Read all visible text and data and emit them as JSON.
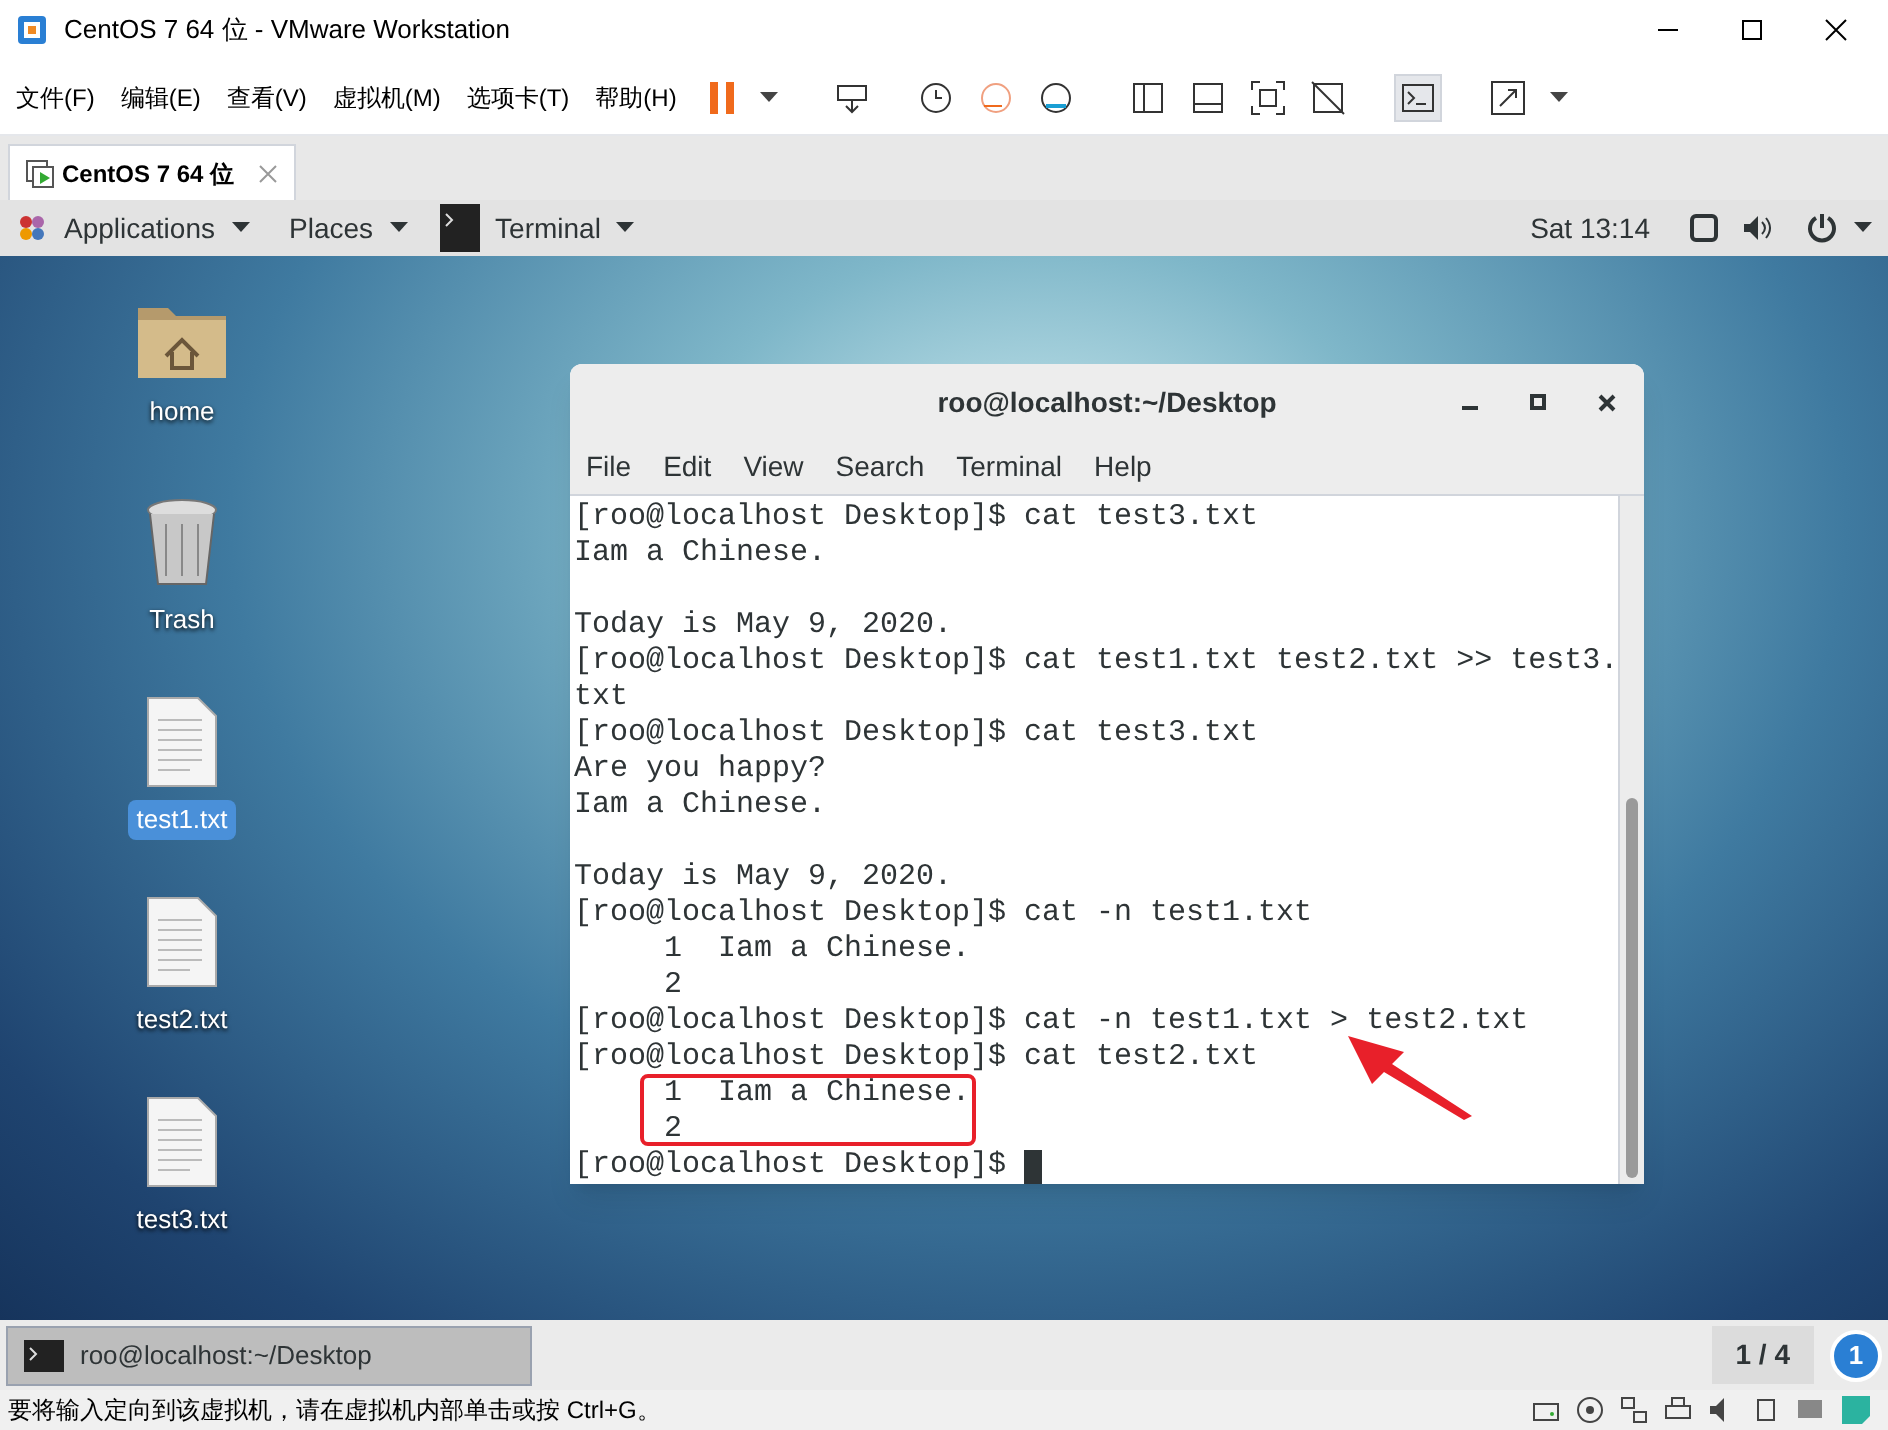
{
  "window": {
    "title": "CentOS 7 64 位 - VMware Workstation"
  },
  "menu": [
    "文件(F)",
    "编辑(E)",
    "查看(V)",
    "虚拟机(M)",
    "选项卡(T)",
    "帮助(H)"
  ],
  "vm_tab": {
    "label": "CentOS 7 64 位",
    "selected": true
  },
  "gnome_bar": {
    "menus": [
      "Applications",
      "Places"
    ],
    "app": "Terminal",
    "clock": "Sat 13:14"
  },
  "desktop_icons": [
    {
      "kind": "folder",
      "label": "home",
      "selected": false
    },
    {
      "kind": "trash",
      "label": "Trash",
      "selected": false
    },
    {
      "kind": "file",
      "label": "test1.txt",
      "selected": true
    },
    {
      "kind": "file",
      "label": "test2.txt",
      "selected": false
    },
    {
      "kind": "file",
      "label": "test3.txt",
      "selected": false
    }
  ],
  "terminal": {
    "title": "roo@localhost:~/Desktop",
    "menu": [
      "File",
      "Edit",
      "View",
      "Search",
      "Terminal",
      "Help"
    ],
    "lines": [
      {
        "kind": "text",
        "text": "[roo@localhost Desktop]$ cat test3.txt"
      },
      {
        "kind": "text",
        "text": "Iam a Chinese."
      },
      {
        "kind": "blank"
      },
      {
        "kind": "text",
        "text": "Today is May 9, 2020."
      },
      {
        "kind": "text",
        "text": "[roo@localhost Desktop]$ cat test1.txt test2.txt >> test3."
      },
      {
        "kind": "text",
        "text": "txt"
      },
      {
        "kind": "text",
        "text": "[roo@localhost Desktop]$ cat test3.txt"
      },
      {
        "kind": "text",
        "text": "Are you happy?"
      },
      {
        "kind": "text",
        "text": "Iam a Chinese."
      },
      {
        "kind": "blank"
      },
      {
        "kind": "text",
        "text": "Today is May 9, 2020."
      },
      {
        "kind": "text",
        "text": "[roo@localhost Desktop]$ cat -n test1.txt"
      },
      {
        "kind": "text",
        "text": "     1  Iam a Chinese."
      },
      {
        "kind": "text",
        "text": "     2"
      },
      {
        "kind": "text",
        "text": "[roo@localhost Desktop]$ cat -n test1.txt > test2.txt"
      },
      {
        "kind": "text",
        "text": "[roo@localhost Desktop]$ cat test2.txt"
      },
      {
        "kind": "text",
        "text": "     1  Iam a Chinese."
      },
      {
        "kind": "text",
        "text": "     2"
      },
      {
        "kind": "text",
        "text": "[roo@localhost Desktop]$ "
      }
    ]
  },
  "taskbar": {
    "window_button": "roo@localhost:~/Desktop",
    "workspace": "1 / 4",
    "notification_count": "1"
  },
  "status_bar": {
    "message": "要将输入定向到该虚拟机，请在虚拟机内部单击或按 Ctrl+G。"
  }
}
